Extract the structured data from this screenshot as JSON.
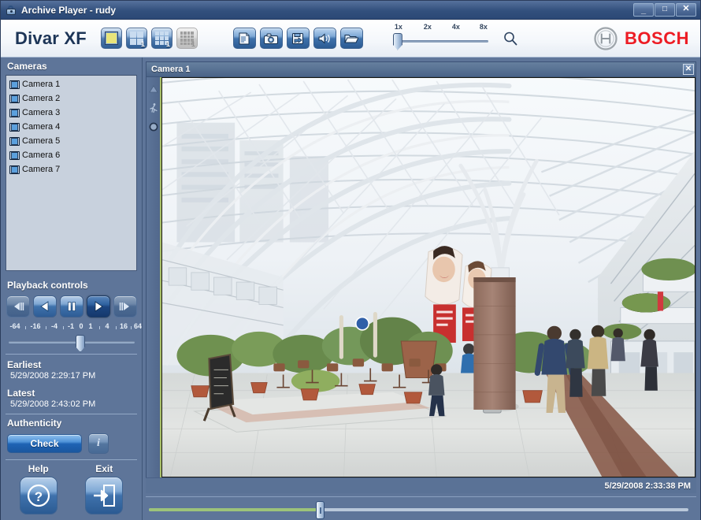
{
  "window": {
    "title": "Archive Player - rudy",
    "icon": "lock-icon",
    "minimize_label": "_",
    "maximize_label": "□",
    "close_label": "✕"
  },
  "brand": {
    "product": "Divar XF",
    "vendor": "BOSCH",
    "vendor_color": "#ed1c24"
  },
  "toolbar": {
    "layouts": [
      {
        "name": "single-view",
        "glyph": "single",
        "badge": "",
        "selected": true,
        "disabled": false
      },
      {
        "name": "quad-view",
        "glyph": "grid2",
        "badge": "1",
        "selected": false,
        "disabled": false
      },
      {
        "name": "nine-view",
        "glyph": "grid3",
        "badge": "1",
        "selected": false,
        "disabled": false
      },
      {
        "name": "sixteen-view",
        "glyph": "grid4",
        "badge": "1",
        "selected": false,
        "disabled": true
      }
    ],
    "tools": [
      {
        "name": "log-icon",
        "label": "Log"
      },
      {
        "name": "camera-snapshot-icon",
        "label": "Snapshot"
      },
      {
        "name": "save-image-icon",
        "label": "Save image"
      },
      {
        "name": "audio-icon",
        "label": "Audio"
      },
      {
        "name": "open-folder-icon",
        "label": "Open file"
      }
    ],
    "zoom": {
      "ticks": [
        "1x",
        "2x",
        "4x",
        "8x"
      ],
      "value": "1x",
      "magnifier_icon": "search-icon"
    }
  },
  "cameras": {
    "title": "Cameras",
    "items": [
      {
        "label": "Camera 1"
      },
      {
        "label": "Camera 2"
      },
      {
        "label": "Camera 3"
      },
      {
        "label": "Camera 4"
      },
      {
        "label": "Camera 5"
      },
      {
        "label": "Camera 6"
      },
      {
        "label": "Camera 7"
      }
    ]
  },
  "playback": {
    "title": "Playback controls",
    "buttons": [
      {
        "name": "step-back-button",
        "icon": "step-backward-icon",
        "state": "dim"
      },
      {
        "name": "reverse-play-button",
        "icon": "play-reverse-icon",
        "state": "normal"
      },
      {
        "name": "pause-button",
        "icon": "pause-icon",
        "state": "normal"
      },
      {
        "name": "play-button",
        "icon": "play-icon",
        "state": "active"
      },
      {
        "name": "step-forward-button",
        "icon": "step-forward-icon",
        "state": "dim"
      }
    ],
    "speed_scale": [
      "-64",
      "-16",
      "-4",
      "-1",
      "0",
      "1",
      "4",
      "16",
      "64"
    ],
    "speed_value": "1"
  },
  "times": {
    "earliest_label": "Earliest",
    "earliest_value": "5/29/2008 2:29:17 PM",
    "latest_label": "Latest",
    "latest_value": "5/29/2008 2:43:02 PM"
  },
  "authenticity": {
    "title": "Authenticity",
    "check_label": "Check",
    "info_glyph": "i",
    "info_name": "info-icon"
  },
  "footer": {
    "help_label": "Help",
    "exit_label": "Exit",
    "help_icon": "question-mark-icon",
    "exit_icon": "exit-door-icon"
  },
  "video": {
    "camera_name": "Camera 1",
    "close_label": "✕",
    "overlay_timestamp": "5/29/2008 2:33:38 PM",
    "status_icons": [
      {
        "name": "alarm-icon"
      },
      {
        "name": "motion-detect-icon"
      },
      {
        "name": "recording-icon"
      }
    ],
    "scene": "shopping mall atrium with vaulted glass roof"
  },
  "timeline": {
    "position_percent": 31
  }
}
